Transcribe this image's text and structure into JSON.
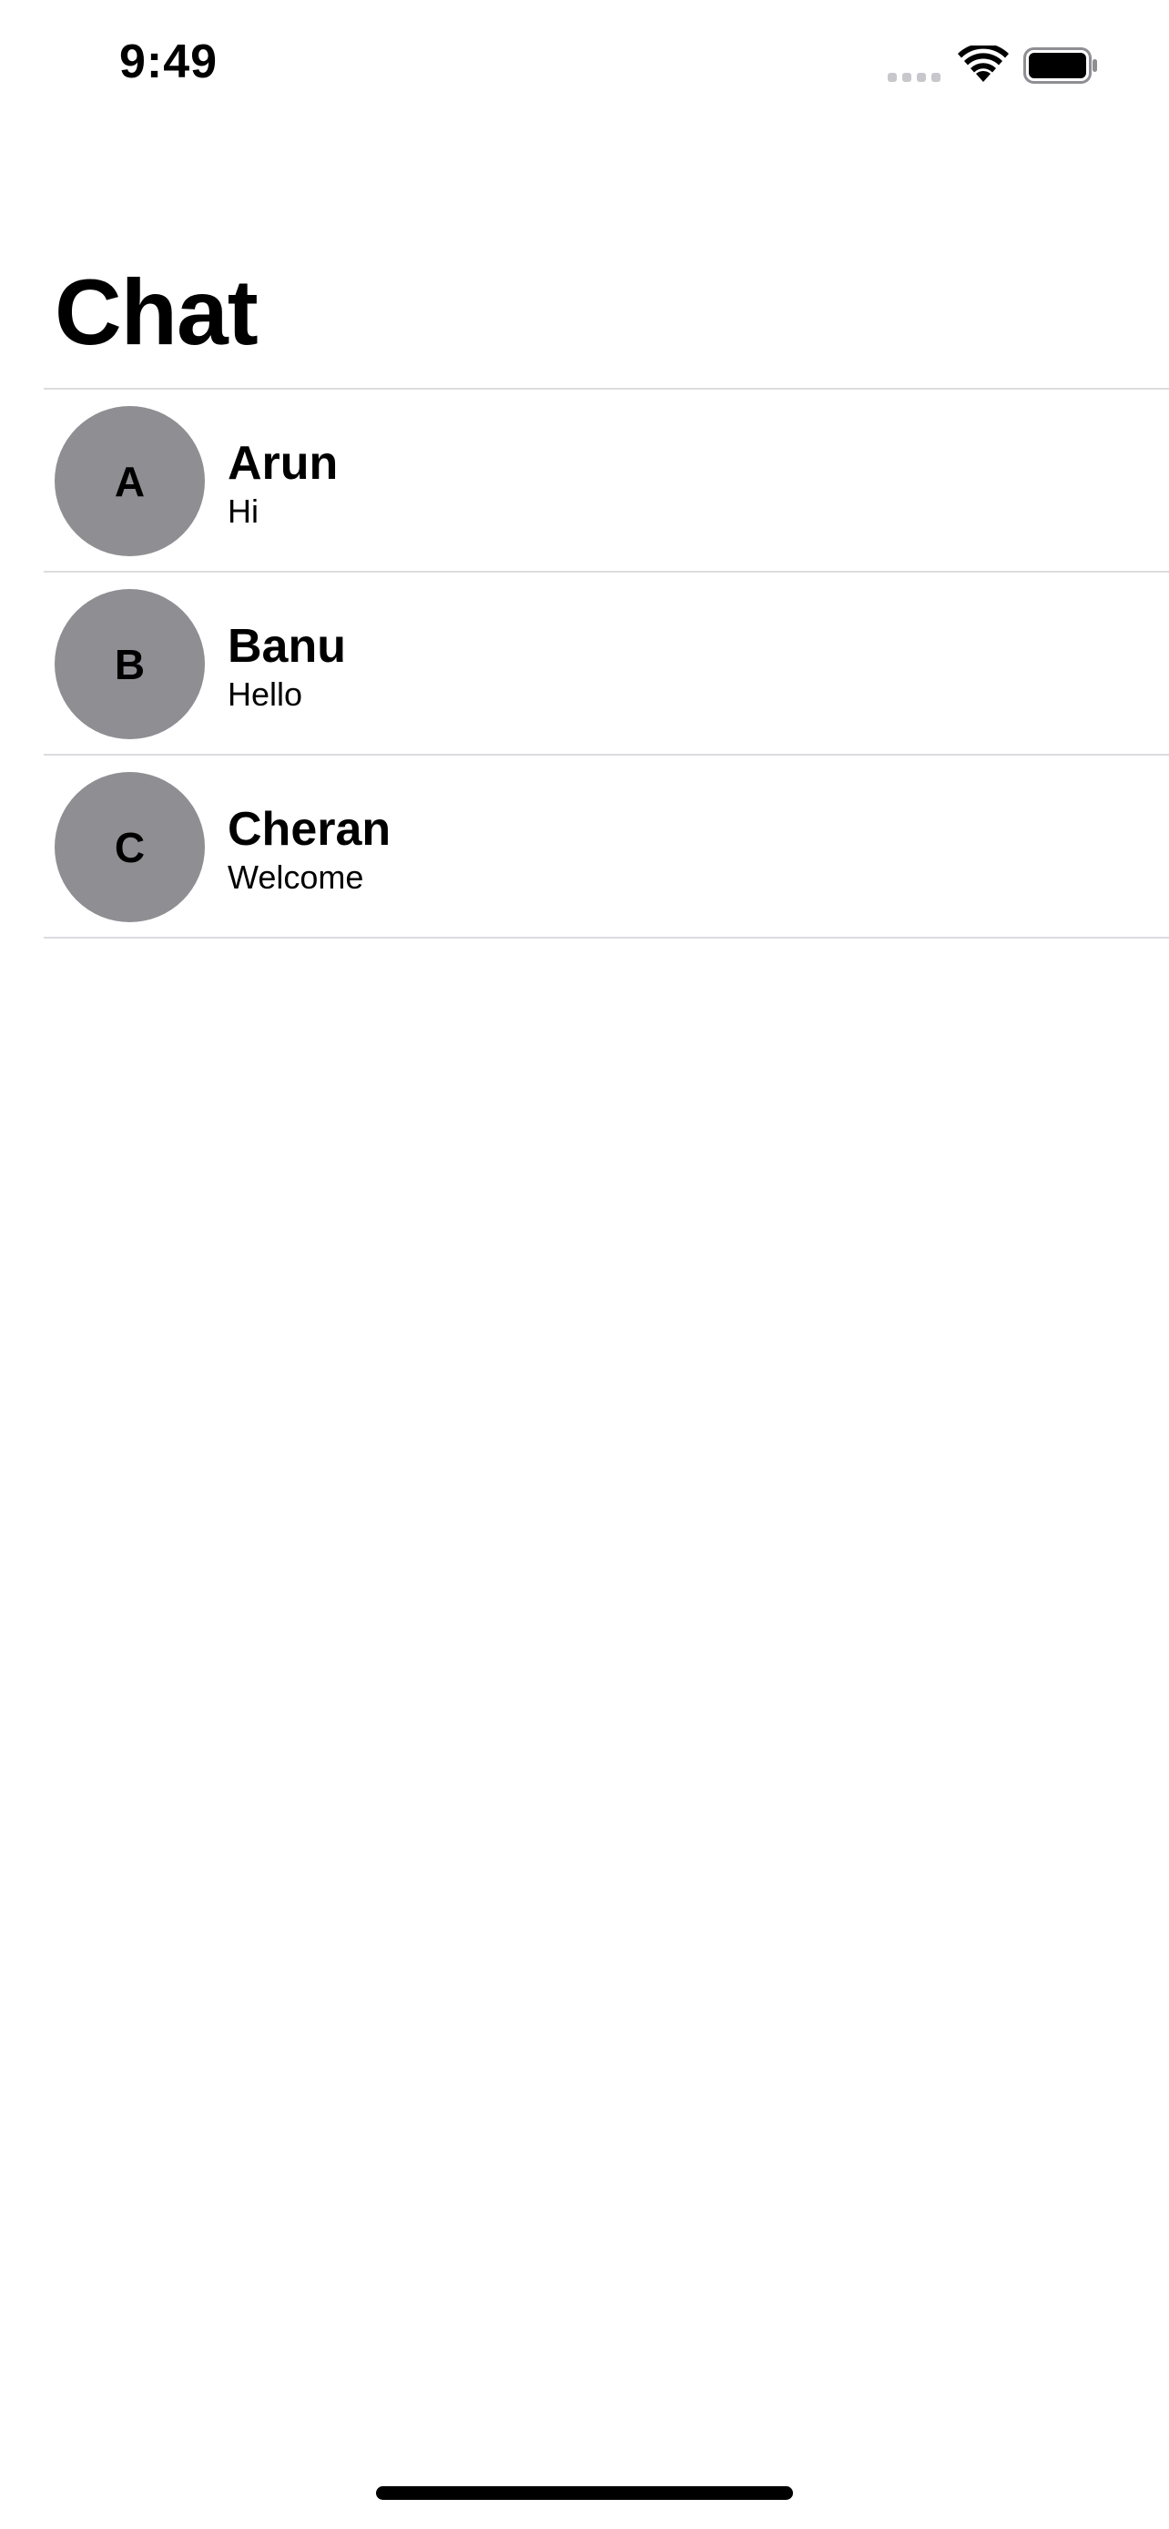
{
  "status_bar": {
    "time": "9:49",
    "icons": [
      "cellular-signal-icon",
      "wifi-icon",
      "battery-icon"
    ]
  },
  "header": {
    "title": "Chat"
  },
  "chats": [
    {
      "initial": "A",
      "name": "Arun",
      "message": "Hi"
    },
    {
      "initial": "B",
      "name": "Banu",
      "message": "Hello"
    },
    {
      "initial": "C",
      "name": "Cheran",
      "message": "Welcome"
    }
  ],
  "colors": {
    "avatar_background": "#8e8e93",
    "divider": "#dcdcdf",
    "signal_inactive": "#c7c7cc",
    "text": "#000000",
    "background": "#ffffff"
  }
}
